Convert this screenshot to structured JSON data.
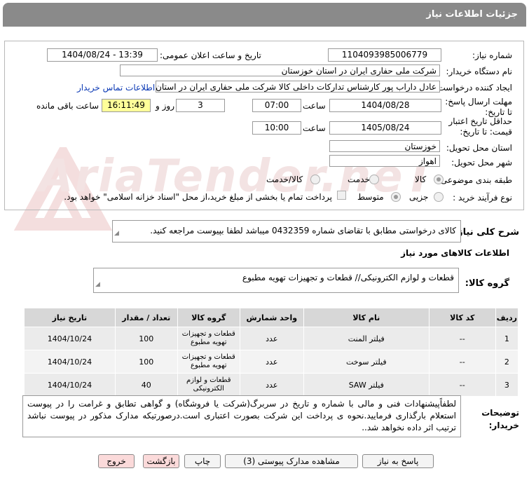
{
  "title": "جزئیات اطلاعات نیاز",
  "form": {
    "need_number_label": "شماره نیاز:",
    "need_number": "1104093985006779",
    "announce_label": "تاریخ و ساعت اعلان عمومی:",
    "announce_value": "1404/08/24 - 13:39",
    "buyer_label": "نام دستگاه خریدار:",
    "buyer_value": "شرکت ملی حفاری ایران در استان خوزستان",
    "creator_label": "ایجاد کننده درخواست:",
    "creator_value": "عادل داراب پور کارشناس تدارکات داخلی کالا شرکت ملی حفاری ایران در استان",
    "contact_link": "اطلاعات تماس خریدار",
    "deadline_label": "مهلت ارسال پاسخ: تا تاریخ:",
    "deadline_date": "1404/08/28",
    "time_label": "ساعت",
    "deadline_time": "07:00",
    "days_value": "3",
    "days_label": "روز و",
    "remaining_time": "16:11:49",
    "remaining_label": "ساعت باقی مانده",
    "validity_label": "حداقل تاریخ اعتبار قیمت: تا تاریخ:",
    "validity_date": "1405/08/24",
    "validity_time": "10:00",
    "province_label": "استان محل تحویل:",
    "province_value": "خوزستان",
    "city_label": "شهر محل تحویل:",
    "city_value": "اهواز",
    "category_label": "طبقه بندی موضوعی:",
    "category_options": [
      "کالا",
      "خدمت",
      "کالا/خدمت"
    ],
    "process_label": "نوع فرآیند خرید :",
    "process_options": [
      "جزیی",
      "متوسط"
    ],
    "payment_note": "پرداخت تمام یا بخشی از مبلغ خرید،از محل \"اسناد خزانه اسلامی\" خواهد بود."
  },
  "summary_label": "شرح کلی نیاز:",
  "summary_text": "کالای درخواستی مطابق با تقاضای شماره    0432359       میباشد لطفا بپیوست مراجعه کنید.",
  "goods_info_title": "اطلاعات کالاهای مورد نیاز",
  "goods_group_label": "گروه کالا:",
  "goods_group_value": "قطعات و لوازم الکترونیکی//  قطعات و تجهیزات تهویه مطبوع",
  "table": {
    "headers": [
      "ردیف",
      "کد کالا",
      "نام کالا",
      "واحد شمارش",
      "گروه کالا",
      "تعداد / مقدار",
      "تاریخ نیاز"
    ],
    "rows": [
      [
        "1",
        "--",
        "فیلتر المنت",
        "عدد",
        "قطعات و تجهیزات تهویه مطبوع",
        "100",
        "1404/10/24"
      ],
      [
        "2",
        "--",
        "فیلتر سوخت",
        "عدد",
        "قطعات و تجهیزات تهویه مطبوع",
        "100",
        "1404/10/24"
      ],
      [
        "3",
        "--",
        "فیلتر SAW",
        "عدد",
        "قطعات و لوازم الکترونیکی",
        "40",
        "1404/10/24"
      ]
    ]
  },
  "buyer_notes_label": "توضیحات خریدار:",
  "buyer_notes": "لطفاًپیشنهادات فنی و مالی با شماره و تاریخ در سربرگ(شرکت یا فروشگاه) و گواهی تطابق و غرامت را در پیوست استعلام بارگذاری فرمایید.نحوه ی پرداخت این شرکت بصورت اعتباری است.درصورتیکه مدارک مذکور در پیوست نباشد ترتیب اثر داده نخواهد شد..",
  "watermark": "AriaTender.neT",
  "buttons": {
    "reply": "پاسخ به نیاز",
    "attachments": "مشاهده مدارک پیوستی (3)",
    "print": "چاپ",
    "back": "بازگشت",
    "exit": "خروج"
  }
}
